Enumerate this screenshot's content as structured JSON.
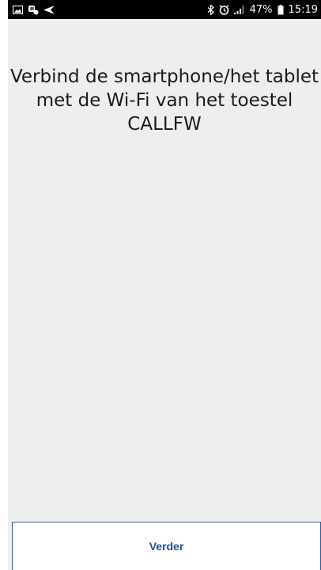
{
  "status_bar": {
    "battery_percent": "47%",
    "time": "15:19",
    "left_icons": [
      "gallery-icon",
      "notification-icon",
      "send-icon"
    ],
    "right_icons": [
      "bluetooth-icon",
      "alarm-icon",
      "signal-icon",
      "battery-icon"
    ]
  },
  "main": {
    "message_lines": [
      "Verbind de smartphone/het tablet",
      "met de Wi-Fi van het toestel",
      "CALLFW"
    ]
  },
  "footer": {
    "next_label": "Verder",
    "accent_color": "#1f5db8"
  }
}
